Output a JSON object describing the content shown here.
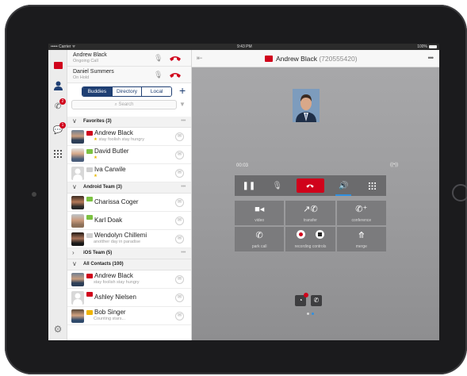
{
  "status_bar": {
    "carrier": "••••• Carrier ᯤ",
    "time": "9:43 PM",
    "battery": "100%"
  },
  "colors": {
    "brand_navy": "#1f3f73",
    "hangup_red": "#d0021b",
    "active_blue": "#2f8fe0"
  },
  "nav_strip": {
    "items": [
      {
        "icon": "red-flag-icon"
      },
      {
        "icon": "person-icon"
      },
      {
        "icon": "missed-calls-icon",
        "badge": "2"
      },
      {
        "icon": "chat-bubbles-icon",
        "badge": "1"
      },
      {
        "icon": "dialpad-icon"
      },
      {
        "icon": "gear-icon"
      }
    ]
  },
  "active_calls": [
    {
      "name": "Andrew Black",
      "status": "Ongoing Call"
    },
    {
      "name": "Daniel Summers",
      "status": "On Hold"
    }
  ],
  "tabs": {
    "buddies": "Buddies",
    "directory": "Directory",
    "local": "Local",
    "selected": "Buddies"
  },
  "search": {
    "placeholder": "Search"
  },
  "groups": {
    "favorites": "Favorites (3)",
    "android": "Android Team (3)",
    "ios": "iOS Team (5)",
    "all": "All Contacts (100)"
  },
  "contacts": {
    "andrew_fav": {
      "name": "Andrew Black",
      "sub": "stay foolish stay hungry"
    },
    "david": {
      "name": "David Butler",
      "sub": ""
    },
    "iva": {
      "name": "Iva Carwile",
      "sub": ""
    },
    "charissa": {
      "name": "Charissa Coger",
      "sub": ""
    },
    "karl": {
      "name": "Karl Doak",
      "sub": ""
    },
    "wendolyn": {
      "name": "Wendolyn Chillemi",
      "sub": "anotther day in paradise"
    },
    "andrew_all": {
      "name": "Andrew Black",
      "sub": "stay foolish stay hungry"
    },
    "ashley": {
      "name": "Ashley Nielsen",
      "sub": ""
    },
    "bob": {
      "name": "Bob Singer",
      "sub": "Counting stars..."
    }
  },
  "call_screen": {
    "caller_name": "Andrew Black",
    "caller_number": "(720555420)",
    "timer": "00:03",
    "features": {
      "video": "video",
      "transfer": "transfer",
      "conference": "conference",
      "park_call": "park call",
      "recording_controls": "recording controls",
      "merge": "merge"
    }
  }
}
